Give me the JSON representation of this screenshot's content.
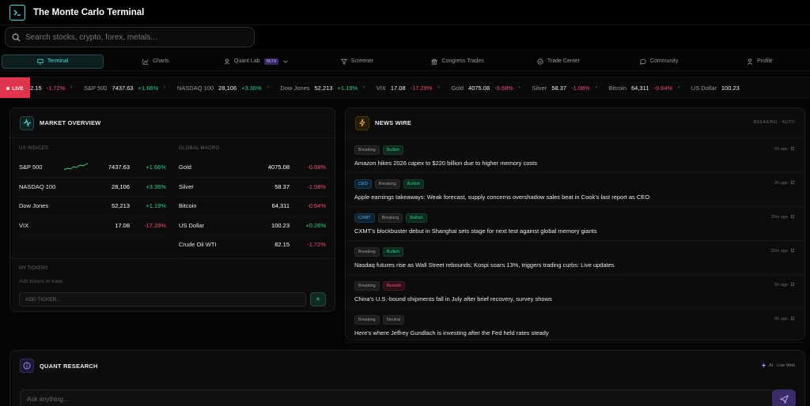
{
  "app": {
    "title": "The Monte Carlo Terminal"
  },
  "search": {
    "placeholder": "Search stocks, crypto, forex, metals..."
  },
  "nav": {
    "items": [
      {
        "label": "Terminal",
        "icon": "monitor-icon",
        "active": true
      },
      {
        "label": "Charts",
        "icon": "chart-icon"
      },
      {
        "label": "Quant Lab",
        "icon": "users-icon",
        "badge": "BETA"
      },
      {
        "label": "Screener",
        "icon": "filter-icon"
      },
      {
        "label": "Congress Trades",
        "icon": "building-icon"
      },
      {
        "label": "Trade Center",
        "icon": "target-icon"
      },
      {
        "label": "Community",
        "icon": "chat-icon"
      },
      {
        "label": "Profile",
        "icon": "user-icon"
      }
    ]
  },
  "ticker": {
    "live_label": "LIVE",
    "items": [
      {
        "name": "",
        "value": "2.15",
        "change": "-1.72%",
        "dir": "down"
      },
      {
        "name": "S&P 500",
        "value": "7437.63",
        "change": "+1.66%",
        "dir": "up"
      },
      {
        "name": "NASDAQ 100",
        "value": "28,106",
        "change": "+3.36%",
        "dir": "up"
      },
      {
        "name": "Dow Jones",
        "value": "52,213",
        "change": "+1.19%",
        "dir": "up"
      },
      {
        "name": "VIX",
        "value": "17.08",
        "change": "-17.29%",
        "dir": "down"
      },
      {
        "name": "Gold",
        "value": "4075.08",
        "change": "-0.68%",
        "dir": "down"
      },
      {
        "name": "Silver",
        "value": "58.37",
        "change": "-1.08%",
        "dir": "down"
      },
      {
        "name": "Bitcoin",
        "value": "64,311",
        "change": "-0.64%",
        "dir": "down"
      },
      {
        "name": "US Dollar",
        "value": "100.23",
        "change": "",
        "dir": "up"
      }
    ]
  },
  "market_overview": {
    "title": "MARKET OVERVIEW",
    "us_label": "US INDICES",
    "macro_label": "GLOBAL MACRO",
    "us": [
      {
        "name": "S&P 500",
        "value": "7437.63",
        "change": "+1.66%",
        "dir": "up",
        "spark": true
      },
      {
        "name": "NASDAQ 100",
        "value": "28,106",
        "change": "+3.36%",
        "dir": "up"
      },
      {
        "name": "Dow Jones",
        "value": "52,213",
        "change": "+1.19%",
        "dir": "up"
      },
      {
        "name": "VIX",
        "value": "17.08",
        "change": "-17.29%",
        "dir": "down"
      }
    ],
    "macro": [
      {
        "name": "Gold",
        "value": "4075.08",
        "change": "-0.68%",
        "dir": "down"
      },
      {
        "name": "Silver",
        "value": "58.37",
        "change": "-1.08%",
        "dir": "down"
      },
      {
        "name": "Bitcoin",
        "value": "64,311",
        "change": "-0.64%",
        "dir": "down"
      },
      {
        "name": "US Dollar",
        "value": "100.23",
        "change": "+0.26%",
        "dir": "up"
      },
      {
        "name": "Crude Oil WTI",
        "value": "82.15",
        "change": "-1.72%",
        "dir": "down"
      }
    ],
    "my_tickers_label": "MY TICKERS",
    "my_tickers_hint": "Add tickers to track",
    "add_placeholder": "ADD TICKER...",
    "add_button": "+"
  },
  "news_wire": {
    "title": "NEWS WIRE",
    "meta": "BREAKING · AUTO",
    "items": [
      {
        "tags": [
          [
            "Breaking",
            "breaking"
          ],
          [
            "Bullish",
            "bullish"
          ]
        ],
        "time": "5h ago",
        "headline": "Amazon hikes 2026 capex to $220 billion due to higher memory costs"
      },
      {
        "tags": [
          [
            "CEO",
            "ticker"
          ],
          [
            "Breaking",
            "breaking"
          ],
          [
            "Bullish",
            "bullish"
          ]
        ],
        "time": "2h ago",
        "headline": "Apple earnings takeaways: Weak forecast, supply concerns overshadow sales beat in Cook's last report as CEO"
      },
      {
        "tags": [
          [
            "CXMT",
            "ticker"
          ],
          [
            "Breaking",
            "breaking"
          ],
          [
            "Bullish",
            "bullish"
          ]
        ],
        "time": "25m ago",
        "headline": "CXMT's blockbuster debut in Shanghai sets stage for next test against global memory giants"
      },
      {
        "tags": [
          [
            "Breaking",
            "breaking"
          ],
          [
            "Bullish",
            "bullish"
          ]
        ],
        "time": "26m ago",
        "headline": "Nasdaq futures rise as Wall Street rebounds; Kospi soars 13%, triggers trading curbs: Live updates"
      },
      {
        "tags": [
          [
            "Breaking",
            "breaking"
          ],
          [
            "Bearish",
            "bearish"
          ]
        ],
        "time": "5h ago",
        "headline": "China's U.S.-bound shipments fall in July after brief recovery, survey shows"
      },
      {
        "tags": [
          [
            "Breaking",
            "breaking"
          ],
          [
            "Neutral",
            "neutral"
          ]
        ],
        "time": "6h ago",
        "headline": "Here's where Jeffrey Gundlach is investing after the Fed held rates steady"
      }
    ]
  },
  "quant_research": {
    "title": "QUANT RESEARCH",
    "meta": "AI · Live Web",
    "placeholder": "Ask anything..."
  },
  "colors": {
    "accent": "#39e3e3",
    "up": "#2ad17e",
    "down": "#f0506e",
    "live": "#e0334d"
  }
}
